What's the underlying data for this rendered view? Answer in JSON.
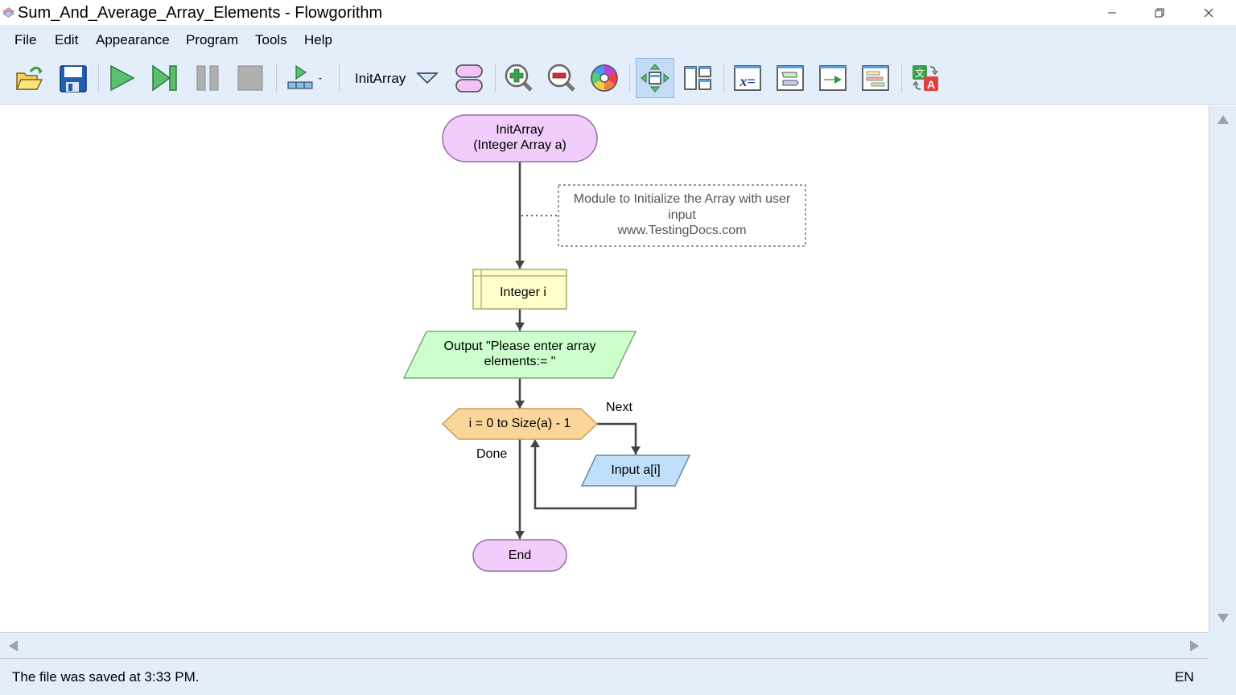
{
  "window": {
    "title": "Sum_And_Average_Array_Elements - Flowgorithm",
    "controls": {
      "minimize": "minimize-icon",
      "maximize": "restore-icon",
      "close": "close-icon"
    }
  },
  "menu": [
    "File",
    "Edit",
    "Appearance",
    "Program",
    "Tools",
    "Help"
  ],
  "toolbar": {
    "function_name": "InitArray",
    "buttons": [
      {
        "name": "open",
        "icon": "open-folder-icon"
      },
      {
        "name": "save",
        "icon": "floppy-disk-icon"
      },
      {
        "name": "run",
        "icon": "play-icon"
      },
      {
        "name": "step",
        "icon": "step-icon"
      },
      {
        "name": "pause",
        "icon": "pause-icon"
      },
      {
        "name": "stop",
        "icon": "stop-icon"
      },
      {
        "name": "run-speed",
        "icon": "speed-icon"
      },
      {
        "name": "function-dropdown",
        "icon": "triangle-down-icon"
      },
      {
        "name": "manage-functions",
        "icon": "functions-icon"
      },
      {
        "name": "zoom-in",
        "icon": "zoom-in-icon"
      },
      {
        "name": "zoom-out",
        "icon": "zoom-out-icon"
      },
      {
        "name": "color-scheme",
        "icon": "color-wheel-icon"
      },
      {
        "name": "auto-layout",
        "icon": "layout-arrows-icon",
        "active": true
      },
      {
        "name": "panel-layout",
        "icon": "panels-icon"
      },
      {
        "name": "variable-watch",
        "icon": "variables-icon"
      },
      {
        "name": "console",
        "icon": "console-icon"
      },
      {
        "name": "output",
        "icon": "output-arrow-icon"
      },
      {
        "name": "source-code",
        "icon": "code-icon"
      },
      {
        "name": "translate",
        "icon": "translate-icon"
      }
    ]
  },
  "flowchart": {
    "start": {
      "line1": "InitArray",
      "line2": "(Integer Array a)"
    },
    "comment": {
      "line1": "Module to Initialize the Array with user",
      "line2": "input",
      "line3": "www.TestingDocs.com"
    },
    "declare": "Integer i",
    "output": {
      "line1": "Output \"Please enter array",
      "line2": "elements:= \""
    },
    "for_loop": "i = 0 to Size(a) - 1",
    "next_label": "Next",
    "done_label": "Done",
    "input": "Input a[i]",
    "end": "End",
    "colors": {
      "terminal": "#f0cdfa",
      "declare": "#ffffcc",
      "output": "#ccffcc",
      "loop": "#fad69b",
      "input": "#bfdffa"
    }
  },
  "status": {
    "message": "The file was saved at 3:33 PM.",
    "language": "EN"
  }
}
